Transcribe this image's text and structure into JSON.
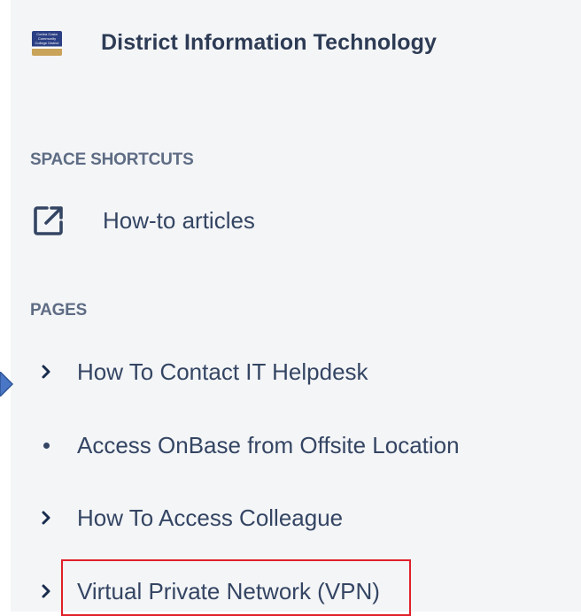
{
  "space": {
    "logo_text": "Contra Costa Community College District",
    "title": "District Information Technology"
  },
  "shortcuts": {
    "heading": "SPACE SHORTCUTS",
    "items": [
      {
        "label": "How-to articles",
        "icon": "external-link-icon"
      }
    ]
  },
  "pages": {
    "heading": "PAGES",
    "items": [
      {
        "label": "How To Contact IT Helpdesk",
        "marker": "chevron-right-icon"
      },
      {
        "label": "Access OnBase from Offsite Location",
        "marker": "bullet-icon"
      },
      {
        "label": "How To Access Colleague",
        "marker": "chevron-right-icon"
      },
      {
        "label": "Virtual Private Network (VPN)",
        "marker": "chevron-right-icon",
        "highlighted": true
      }
    ]
  },
  "colors": {
    "sidebar_bg": "#f4f5f7",
    "text": "#344563",
    "section_label": "#5e6c84",
    "highlight_border": "#e0202a",
    "pointer_arrow": "#4a76c6"
  }
}
